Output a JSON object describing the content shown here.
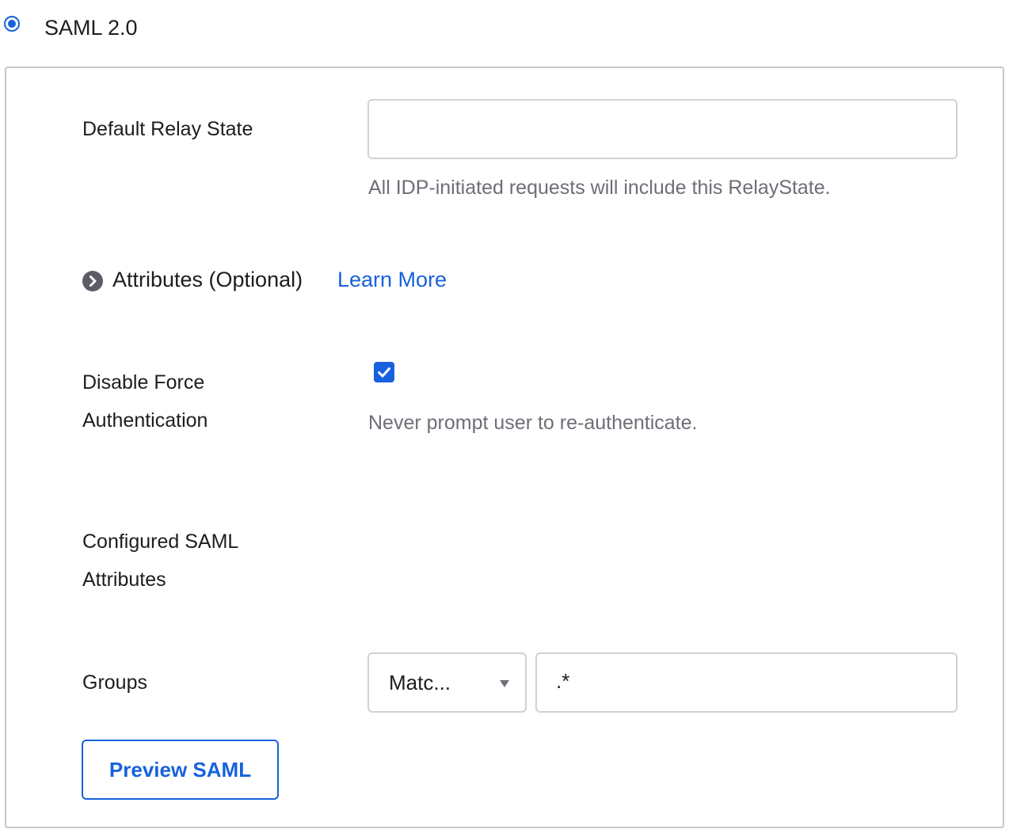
{
  "saml_option": {
    "label": "SAML 2.0",
    "selected": true
  },
  "relay_state": {
    "label": "Default Relay State",
    "value": "",
    "placeholder": "",
    "hint": "All IDP-initiated requests will include this RelayState."
  },
  "attributes": {
    "label": "Attributes (Optional)",
    "learn_more": "Learn More",
    "icon": "chevron-right-circle-icon"
  },
  "force_auth": {
    "label_line1": "Disable Force",
    "label_line2": "Authentication",
    "checked": true,
    "hint": "Never prompt user to re-authenticate."
  },
  "configured_attributes": {
    "label_line1": "Configured SAML",
    "label_line2": "Attributes"
  },
  "groups": {
    "label": "Groups",
    "filter_selected": "Matc...",
    "filter_value": ".*"
  },
  "preview_button": {
    "label": "Preview SAML"
  },
  "colors": {
    "accent": "#1662dd",
    "border": "#d1d1d6",
    "hint_text": "#6e6e78"
  }
}
